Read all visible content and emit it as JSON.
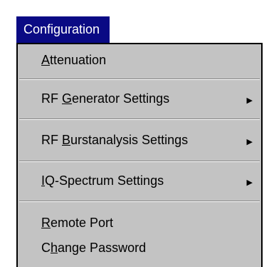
{
  "menu": {
    "title": "Configuration",
    "items": [
      {
        "pre": "",
        "mn": "A",
        "post": "ttenuation",
        "submenu": false
      },
      {
        "pre": "RF ",
        "mn": "G",
        "post": "enerator Settings",
        "submenu": true
      },
      {
        "pre": "RF ",
        "mn": "B",
        "post": "urstanalysis Settings",
        "submenu": true
      },
      {
        "pre": "",
        "mn": "I",
        "post": "Q-Spectrum Settings",
        "submenu": true
      },
      {
        "pre": "",
        "mn": "R",
        "post": "emote Port",
        "submenu": false
      },
      {
        "pre": "C",
        "mn": "h",
        "post": "ange Password",
        "submenu": false
      }
    ],
    "arrow_glyph": "▶"
  }
}
